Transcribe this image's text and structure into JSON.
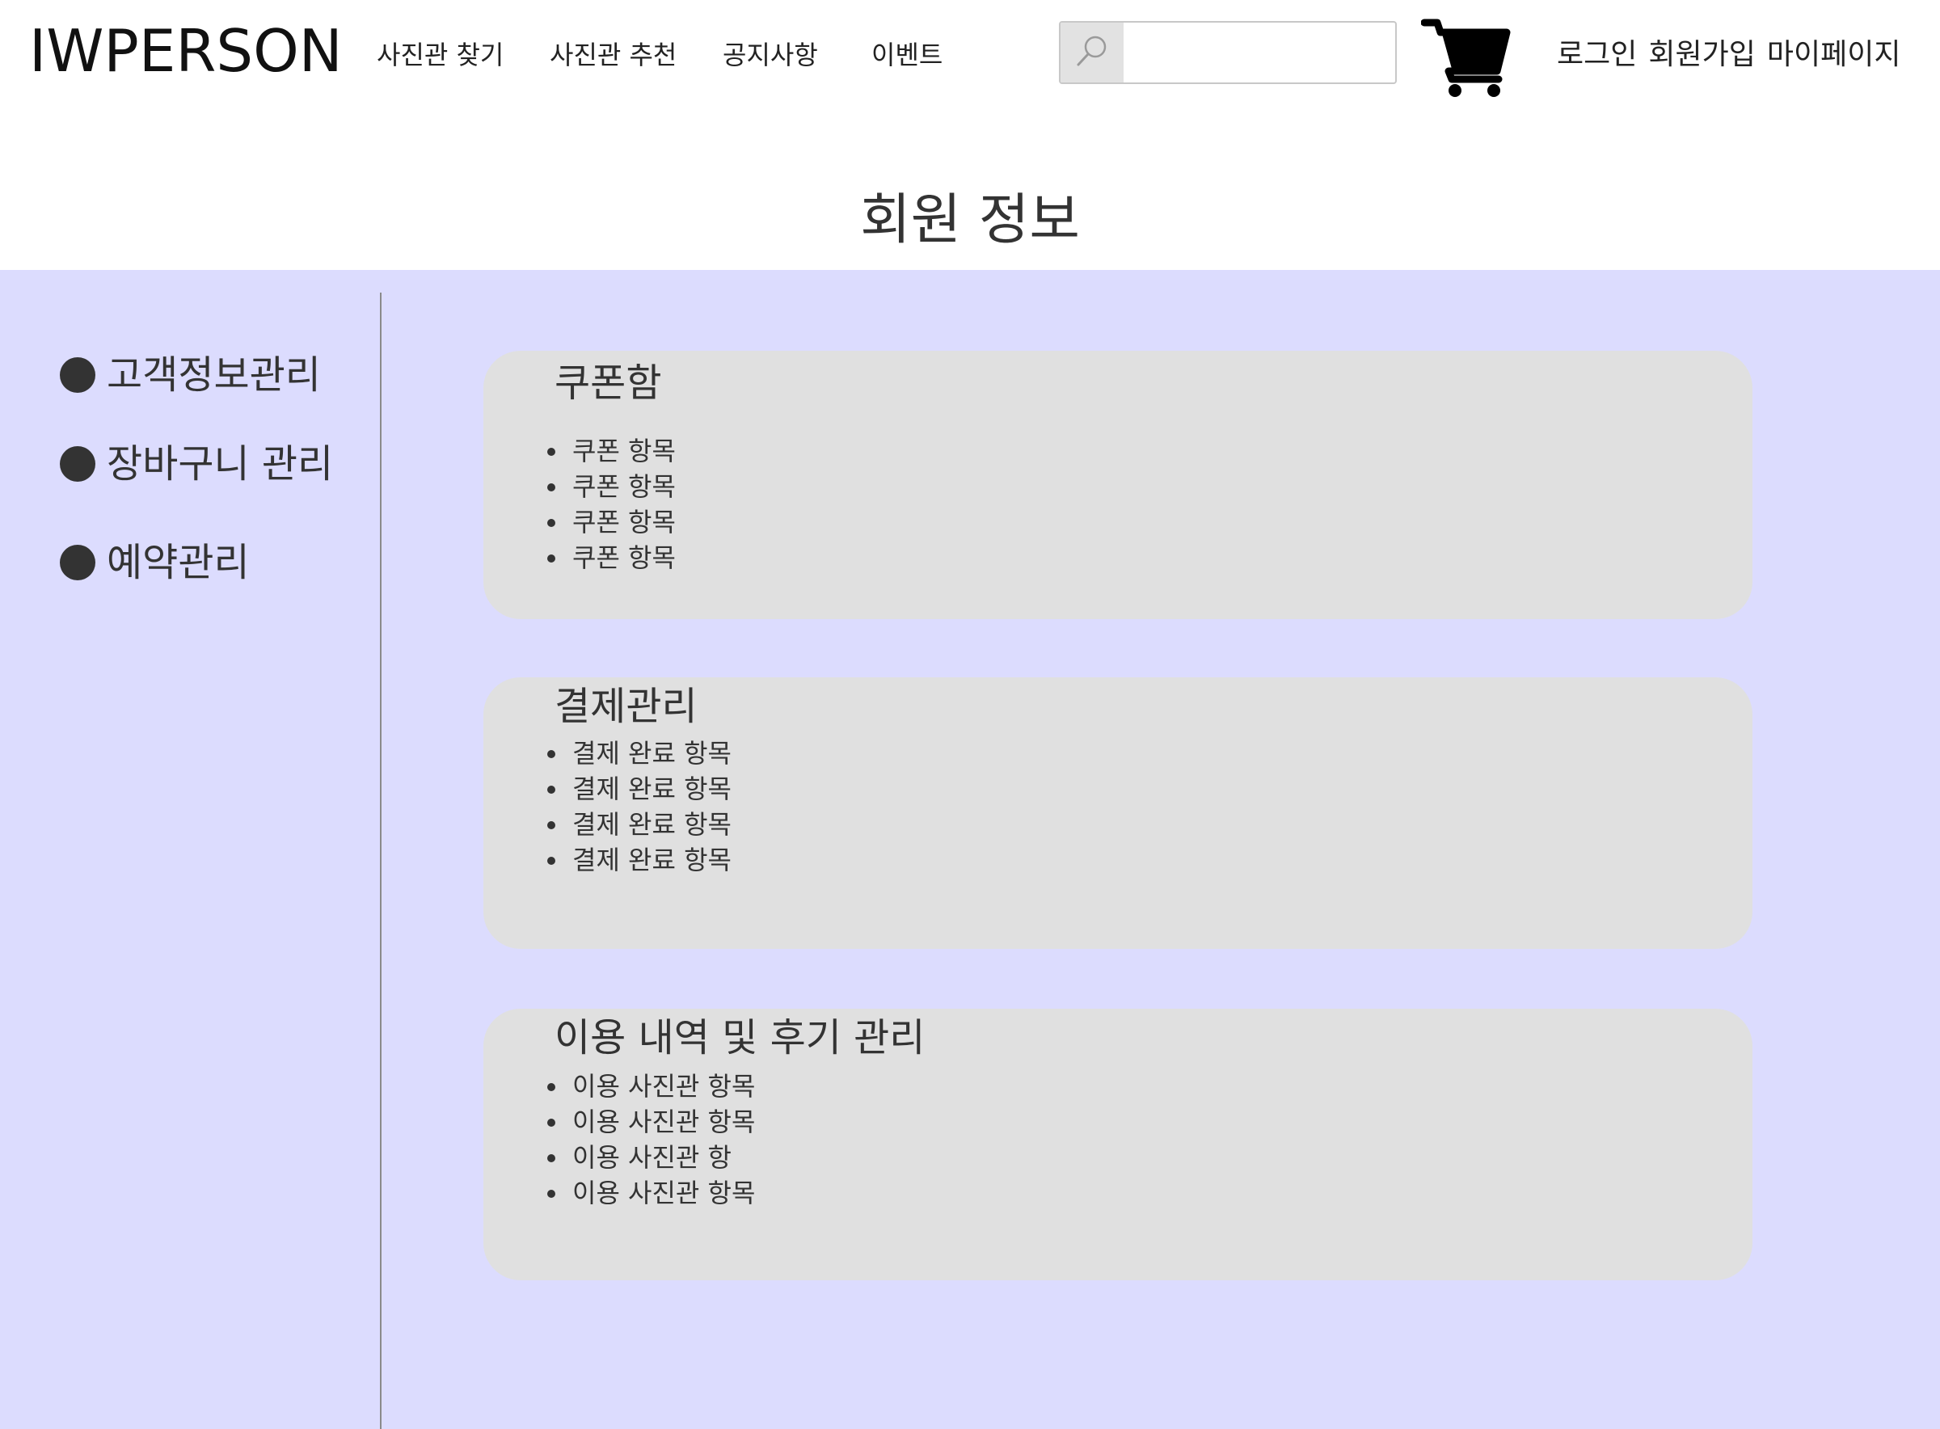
{
  "header": {
    "logo": "IWPERSON",
    "nav": [
      {
        "label": "사진관 찾기"
      },
      {
        "label": "사진관 추천"
      },
      {
        "label": "공지사항"
      },
      {
        "label": "이벤트"
      }
    ],
    "search": {
      "placeholder": "",
      "value": "",
      "icon": "search-icon"
    },
    "cart_icon": "cart-icon",
    "account": {
      "login": "로그인",
      "signup": "회원가입",
      "mypage": "마이페이지"
    }
  },
  "page": {
    "title": "회원 정보"
  },
  "sidebar": {
    "items": [
      {
        "label": "고객정보관리"
      },
      {
        "label": "장바구니 관리"
      },
      {
        "label": "예약관리"
      }
    ]
  },
  "sections": [
    {
      "title": "쿠폰함",
      "items": [
        "쿠폰 항목",
        "쿠폰 항목",
        "쿠폰 항목",
        "쿠폰 항목"
      ]
    },
    {
      "title": "결제관리",
      "items": [
        "결제 완료 항목",
        "결제 완료 항목",
        "결제 완료 항목",
        "결제 완료 항목"
      ]
    },
    {
      "title": "이용 내역 및 후기 관리",
      "items": [
        "이용 사진관 항목",
        "이용 사진관 항목",
        "이용 사진관 항",
        "이용 사진관 항목"
      ]
    }
  ],
  "colors": {
    "main_background": "#dcdcfe",
    "panel_background": "#e0e0e0",
    "text": "#333333"
  }
}
